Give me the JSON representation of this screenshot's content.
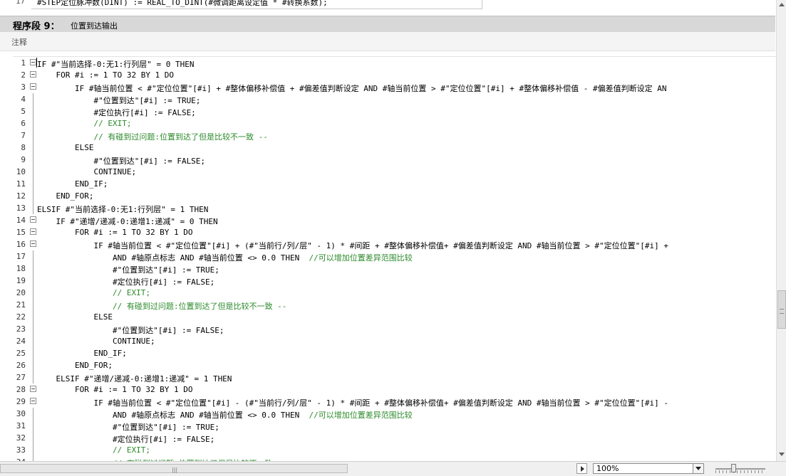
{
  "top_line": {
    "number": "17",
    "text": "#STEP定位脉冲数(DINT) := REAL_TO_DINT(#微调距离设定值 * #转换系数);"
  },
  "segment": {
    "title": "程序段 9：",
    "name": "位置到达输出"
  },
  "comment_label": "注释",
  "lines": [
    {
      "n": "1",
      "fold": true,
      "code": "IF #\"当前选择-0:无1:行列层\" = 0 THEN"
    },
    {
      "n": "2",
      "fold": true,
      "code": "    FOR #i := 1 TO 32 BY 1 DO"
    },
    {
      "n": "3",
      "fold": true,
      "code": "        IF #轴当前位置 < #\"定位位置\"[#i] + #整体偏移补偿值 + #偏差值判断设定 AND #轴当前位置 > #\"定位位置\"[#i] + #整体偏移补偿值 - #偏差值判断设定 AN"
    },
    {
      "n": "4",
      "fold": false,
      "code": "            #\"位置到达\"[#i] := TRUE;"
    },
    {
      "n": "5",
      "fold": false,
      "code": "            #定位执行[#i] := FALSE;"
    },
    {
      "n": "6",
      "fold": false,
      "code": "            // EXIT;",
      "comment": true
    },
    {
      "n": "7",
      "fold": false,
      "code": "            // 有碰到过问题:位置到达了但是比较不一致 --",
      "comment": true
    },
    {
      "n": "8",
      "fold": false,
      "code": "        ELSE"
    },
    {
      "n": "9",
      "fold": false,
      "code": "            #\"位置到达\"[#i] := FALSE;"
    },
    {
      "n": "10",
      "fold": false,
      "code": "            CONTINUE;"
    },
    {
      "n": "11",
      "fold": false,
      "code": "        END_IF;"
    },
    {
      "n": "12",
      "fold": false,
      "code": "    END_FOR;"
    },
    {
      "n": "13",
      "fold": false,
      "code": "ELSIF #\"当前选择-0:无1:行列层\" = 1 THEN"
    },
    {
      "n": "14",
      "fold": true,
      "code": "    IF #\"递增/递减-0:递增1:递减\" = 0 THEN"
    },
    {
      "n": "15",
      "fold": true,
      "code": "        FOR #i := 1 TO 32 BY 1 DO"
    },
    {
      "n": "16",
      "fold": true,
      "code": "            IF #轴当前位置 < #\"定位位置\"[#i] + (#\"当前行/列/层\" - 1) * #间距 + #整体偏移补偿值+ #偏差值判断设定 AND #轴当前位置 > #\"定位位置\"[#i] +"
    },
    {
      "n": "17",
      "fold": false,
      "code": "                AND #轴原点标志 AND #轴当前位置 <> 0.0 THEN  ",
      "tail": "//可以增加位置差异范围比较"
    },
    {
      "n": "18",
      "fold": false,
      "code": "                #\"位置到达\"[#i] := TRUE;"
    },
    {
      "n": "19",
      "fold": false,
      "code": "                #定位执行[#i] := FALSE;"
    },
    {
      "n": "20",
      "fold": false,
      "code": "                // EXIT;",
      "comment": true
    },
    {
      "n": "21",
      "fold": false,
      "code": "                // 有碰到过问题:位置到达了但是比较不一致 --",
      "comment": true
    },
    {
      "n": "22",
      "fold": false,
      "code": "            ELSE"
    },
    {
      "n": "23",
      "fold": false,
      "code": "                #\"位置到达\"[#i] := FALSE;"
    },
    {
      "n": "24",
      "fold": false,
      "code": "                CONTINUE;"
    },
    {
      "n": "25",
      "fold": false,
      "code": "            END_IF;"
    },
    {
      "n": "26",
      "fold": false,
      "code": "        END_FOR;"
    },
    {
      "n": "27",
      "fold": false,
      "code": "    ELSIF #\"递增/递减-0:递增1:递减\" = 1 THEN"
    },
    {
      "n": "28",
      "fold": true,
      "code": "        FOR #i := 1 TO 32 BY 1 DO"
    },
    {
      "n": "29",
      "fold": true,
      "code": "            IF #轴当前位置 < #\"定位位置\"[#i] - (#\"当前行/列/层\" - 1) * #间距 + #整体偏移补偿值+ #偏差值判断设定 AND #轴当前位置 > #\"定位位置\"[#i] -"
    },
    {
      "n": "30",
      "fold": false,
      "code": "                AND #轴原点标志 AND #轴当前位置 <> 0.0 THEN  ",
      "tail": "//可以增加位置差异范围比较"
    },
    {
      "n": "31",
      "fold": false,
      "code": "                #\"位置到达\"[#i] := TRUE;"
    },
    {
      "n": "32",
      "fold": false,
      "code": "                #定位执行[#i] := FALSE;"
    },
    {
      "n": "33",
      "fold": false,
      "code": "                // EXIT;",
      "comment": true
    },
    {
      "n": "34",
      "fold": false,
      "code": "                // 有碰到过问题:位置到达了但是比较不一致 --",
      "comment": true
    }
  ],
  "zoom": {
    "value": "100%"
  },
  "colors": {
    "comment": "#2b8a2b",
    "header_bg": "#d8d8d8"
  }
}
